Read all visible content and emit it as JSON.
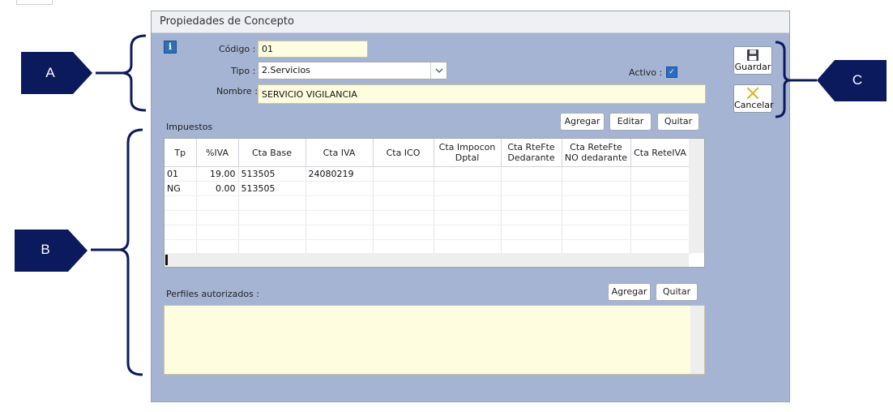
{
  "window": {
    "title": "Propiedades de Concepto"
  },
  "header": {
    "codigo_label": "Código :",
    "codigo_value": "01",
    "tipo_label": "Tipo :",
    "tipo_value": "2.Servicios",
    "nombre_label": "Nombre :",
    "nombre_value": "SERVICIO VIGILANCIA",
    "activo_label": "Activo :",
    "activo_checked": true,
    "info_icon": "i"
  },
  "impuestos": {
    "section_label": "Impuestos",
    "buttons": {
      "agregar": "Agregar",
      "editar": "Editar",
      "quitar": "Quitar"
    },
    "columns": [
      "Tp",
      "%IVA",
      "Cta Base",
      "Cta IVA",
      "Cta ICO",
      "Cta Impocon Dptal",
      "Cta RteFte Dedarante",
      "Cta ReteFte NO dedarante",
      "Cta ReteIVA"
    ],
    "rows": [
      [
        "01",
        "19.00",
        "513505",
        "24080219",
        "",
        "",
        "",
        "",
        ""
      ],
      [
        "NG",
        "0.00",
        "513505",
        "",
        "",
        "",
        "",
        "",
        ""
      ]
    ]
  },
  "perfiles": {
    "section_label": "Perfiles autorizados :",
    "buttons": {
      "agregar": "Agregar",
      "quitar": "Quitar"
    }
  },
  "side": {
    "guardar": "Guardar",
    "cancelar": "Cancelar"
  },
  "callouts": {
    "a": "A",
    "b": "B",
    "c": "C"
  },
  "icons": {
    "save": "floppy-disk-icon",
    "cancel": "x-icon",
    "info": "info-icon",
    "dropdown": "chevron-down-icon"
  },
  "colors": {
    "window_bg": "#a6b4d3",
    "field_bg": "#fffde0",
    "callout": "#0b1a5c"
  }
}
